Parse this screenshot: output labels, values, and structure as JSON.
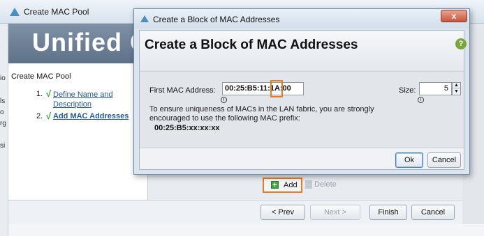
{
  "background_window": {
    "title": "Create MAC Pool",
    "banner_text": "Unified C",
    "left_edge_fragments": [
      "io",
      "ls",
      "o",
      "rg",
      "si"
    ],
    "wizard": {
      "heading": "Create MAC Pool",
      "steps": [
        {
          "number": "1.",
          "label": "Define Name and Description",
          "check": "√"
        },
        {
          "number": "2.",
          "label": "Add MAC Addresses",
          "check": "√"
        }
      ]
    },
    "toolbar": {
      "add_icon": "+",
      "add_label": "Add",
      "delete_label": "Delete"
    },
    "buttons": {
      "prev": "< Prev",
      "next": "Next >",
      "finish": "Finish",
      "cancel": "Cancel"
    }
  },
  "dialog": {
    "title": "Create a Block of MAC Addresses",
    "close_glyph": "x",
    "heading": "Create a Block of MAC Addresses",
    "help_glyph": "?",
    "first_mac": {
      "label": "First MAC Address:",
      "prefix_part": "00:25:B5:11:",
      "highlighted_part": "1A",
      "suffix_part": ":00"
    },
    "size": {
      "label": "Size:",
      "value": "5",
      "up_glyph": "▲",
      "down_glyph": "▼"
    },
    "info_glyph": "i",
    "note": "To ensure uniqueness of MACs in the LAN fabric, you are strongly encouraged to use the following MAC prefix:",
    "mac_prefix": "00:25:B5:xx:xx:xx",
    "buttons": {
      "ok": "Ok",
      "cancel": "Cancel"
    }
  },
  "colors": {
    "highlight": "#f07b1d",
    "title_bar": "#d9e3ee",
    "check_green": "#2f9e2f",
    "link_blue": "#245a9c"
  }
}
